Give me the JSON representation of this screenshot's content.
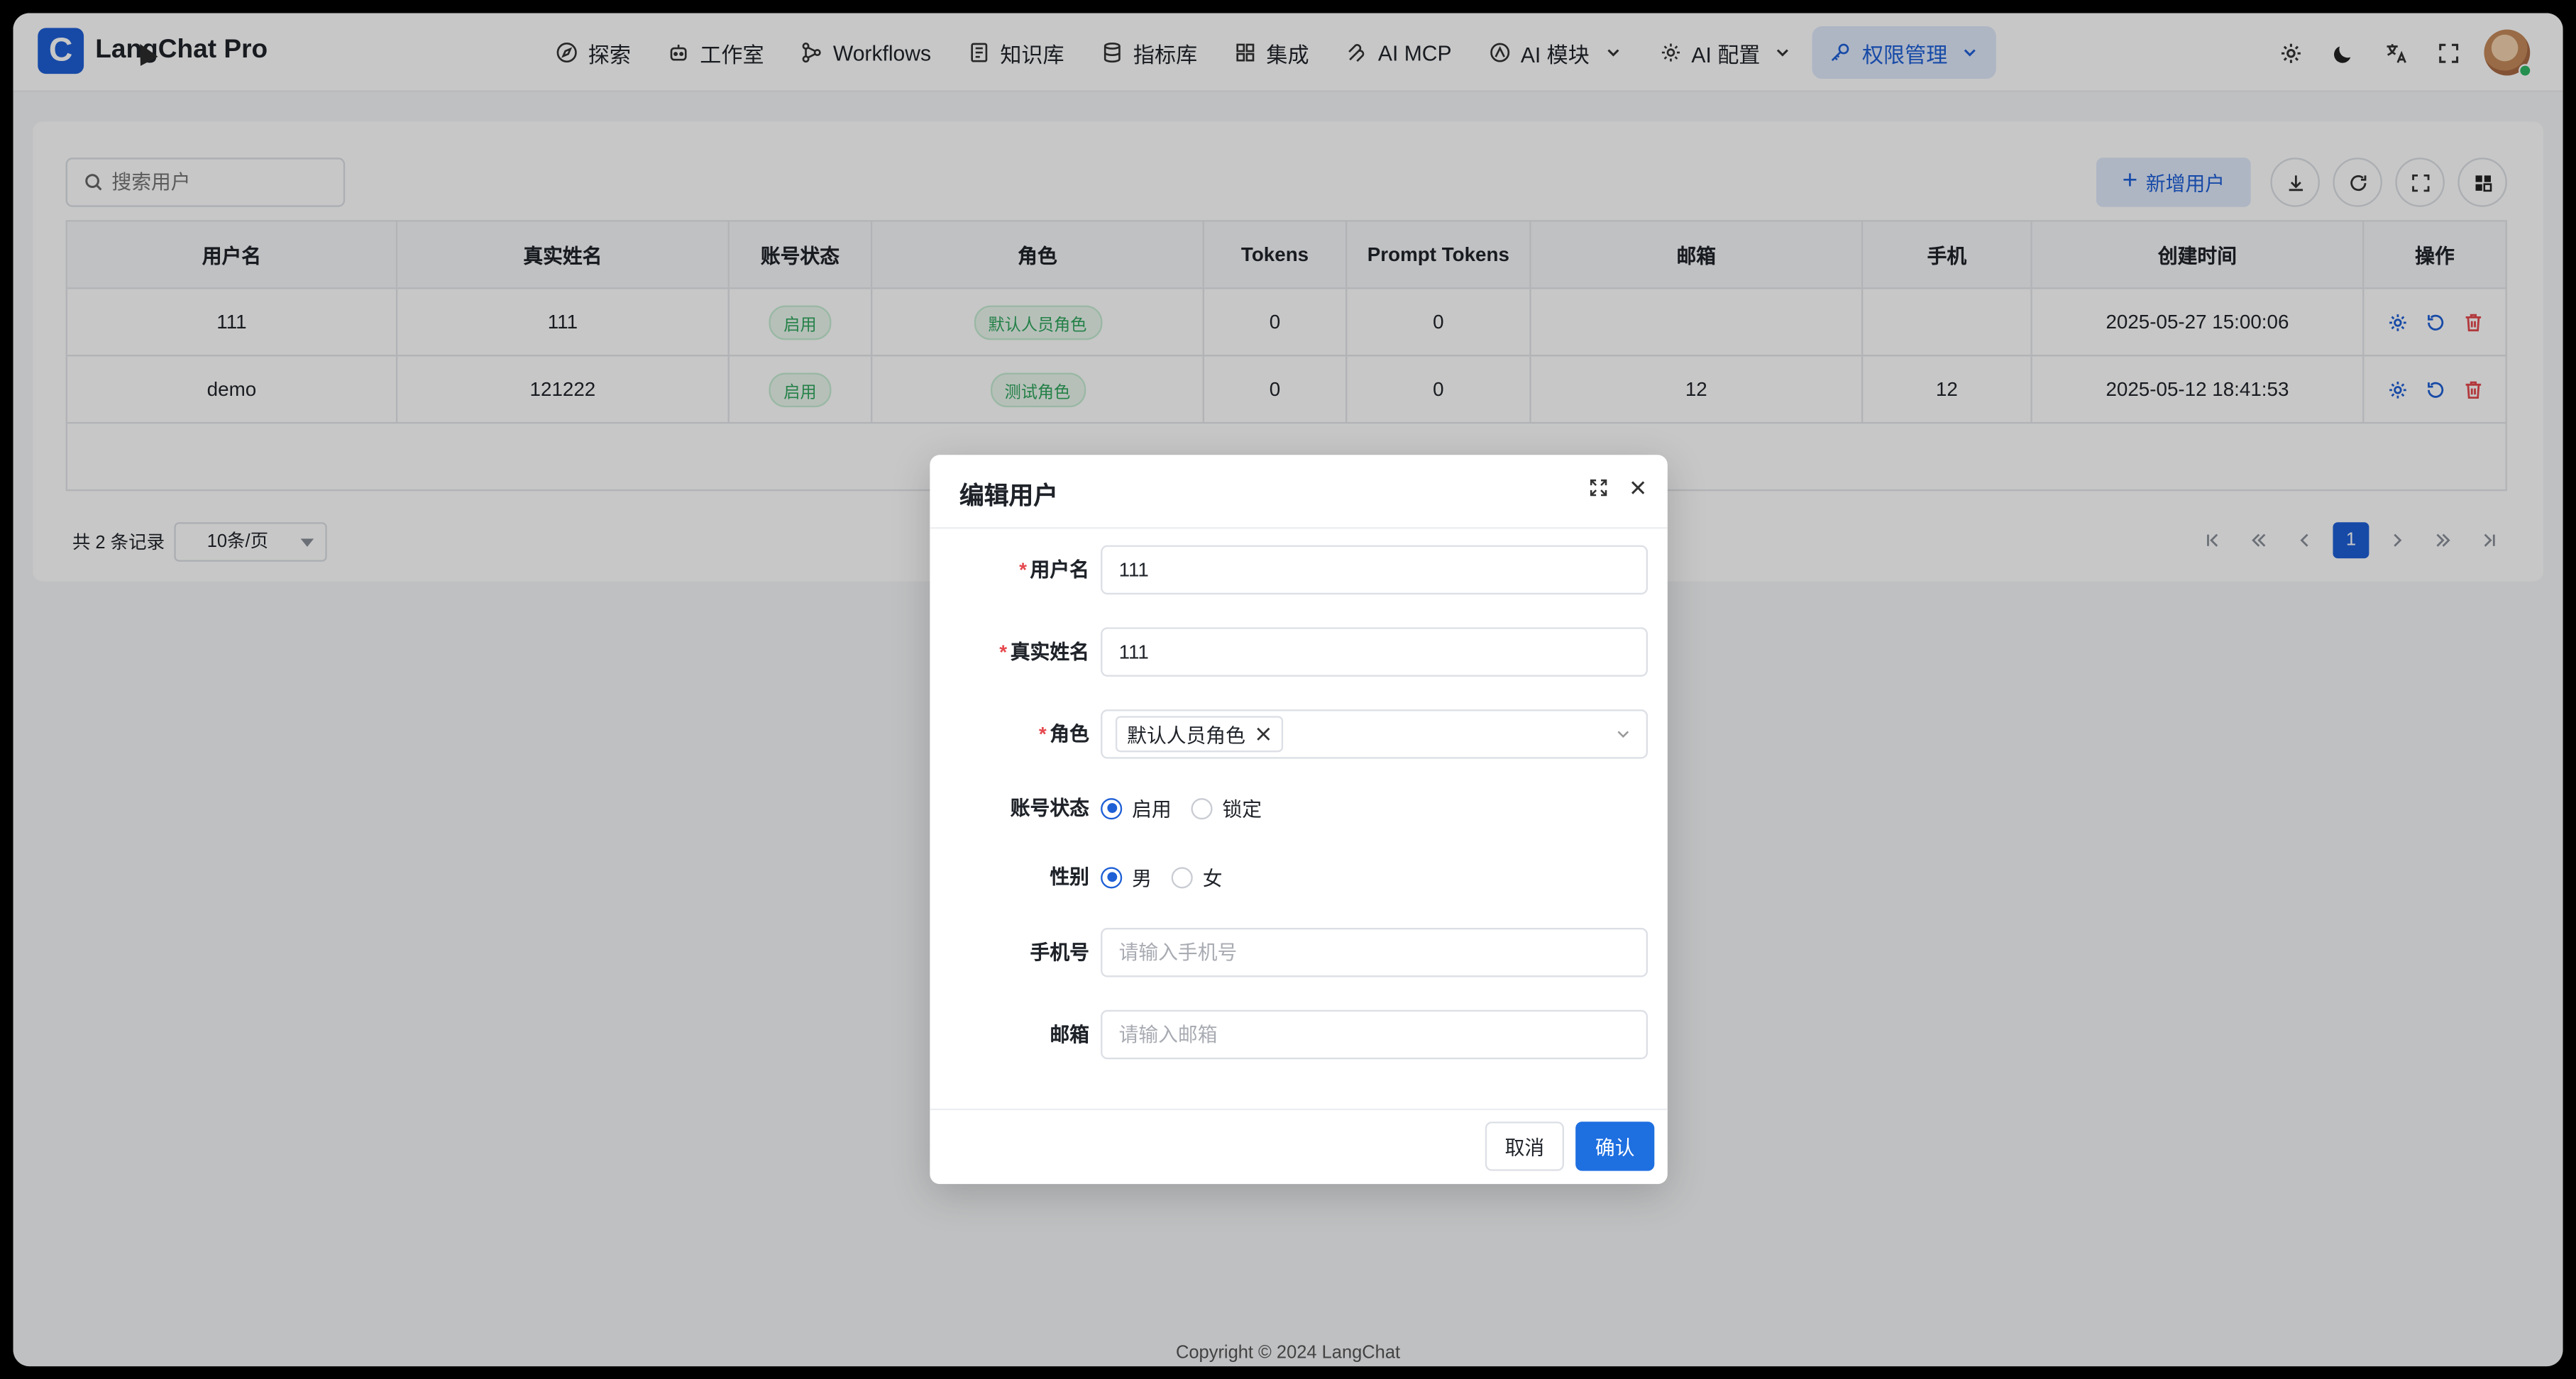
{
  "app": {
    "logo_letter": "C",
    "title": "LangChat Pro"
  },
  "nav": [
    {
      "label": "探索",
      "icon": "compass-icon"
    },
    {
      "label": "工作室",
      "icon": "robot-icon"
    },
    {
      "label": "Workflows",
      "icon": "workflow-icon"
    },
    {
      "label": "知识库",
      "icon": "book-icon"
    },
    {
      "label": "指标库",
      "icon": "database-icon"
    },
    {
      "label": "集成",
      "icon": "grid-icon"
    },
    {
      "label": "AI MCP",
      "icon": "mcp-icon"
    },
    {
      "label": "AI 模块",
      "icon": "module-icon"
    },
    {
      "label": "AI 配置",
      "icon": "gear-icon"
    },
    {
      "label": "权限管理",
      "icon": "key-icon",
      "active": true
    }
  ],
  "toolbar": {
    "search_placeholder": "搜索用户",
    "add_label": "新增用户"
  },
  "table": {
    "columns": [
      "用户名",
      "真实姓名",
      "账号状态",
      "角色",
      "Tokens",
      "Prompt Tokens",
      "邮箱",
      "手机",
      "创建时间",
      "操作"
    ],
    "rows": [
      {
        "username": "111",
        "realname": "111",
        "status": "启用",
        "role": "默认人员角色",
        "tokens": "0",
        "prompt_tokens": "0",
        "email": "",
        "phone": "",
        "created": "2025-05-27 15:00:06"
      },
      {
        "username": "demo",
        "realname": "121222",
        "status": "启用",
        "role": "测试角色",
        "tokens": "0",
        "prompt_tokens": "0",
        "email": "12",
        "phone": "12",
        "created": "2025-05-12 18:41:53"
      }
    ]
  },
  "pager": {
    "total": "共 2 条记录",
    "page_size": "10条/页",
    "current_page": "1"
  },
  "footer": "Copyright © 2024 LangChat",
  "modal": {
    "title": "编辑用户",
    "fields": {
      "username_label": "用户名",
      "username_value": "111",
      "realname_label": "真实姓名",
      "realname_value": "111",
      "role_label": "角色",
      "role_chip": "默认人员角色",
      "status_label": "账号状态",
      "status_on": "启用",
      "status_off": "锁定",
      "gender_label": "性别",
      "gender_male": "男",
      "gender_female": "女",
      "phone_label": "手机号",
      "phone_placeholder": "请输入手机号",
      "email_label": "邮箱",
      "email_placeholder": "请输入邮箱"
    },
    "cancel_label": "取消",
    "ok_label": "确认"
  },
  "colors": {
    "primary": "#1e5fd6",
    "success": "#2fa55c",
    "danger": "#e5484d"
  }
}
